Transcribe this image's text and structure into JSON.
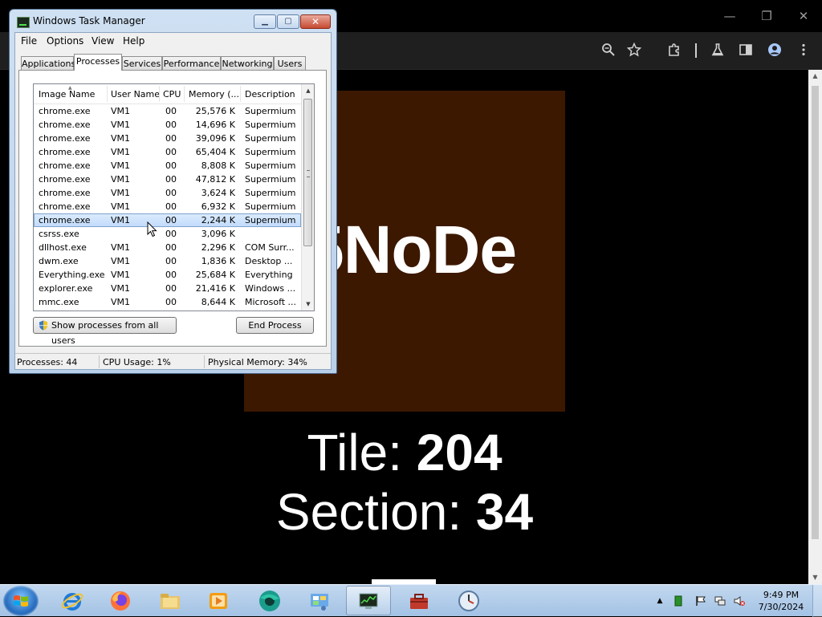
{
  "browser": {
    "window_controls": {
      "minimize": "—",
      "restore": "❐",
      "close": "✕"
    },
    "toolbar_icons": [
      "zoom-icon",
      "bookmark-star-icon",
      "extensions-icon",
      "labs-flask-icon",
      "side-panel-icon",
      "profile-icon",
      "menu-icon"
    ],
    "page": {
      "tile_text": "5NoDe",
      "tile_color": "#3c1800",
      "tile_label": "Tile:",
      "tile_number": "204",
      "section_label": "Section:",
      "section_number": "34"
    }
  },
  "task_manager": {
    "title": "Windows Task Manager",
    "title_buttons": {
      "minimize": "▁",
      "maximize": "▢",
      "close": "✕"
    },
    "menu": [
      "File",
      "Options",
      "View",
      "Help"
    ],
    "tabs": [
      "Applications",
      "Processes",
      "Services",
      "Performance",
      "Networking",
      "Users"
    ],
    "active_tab": "Processes",
    "columns": [
      "Image Name",
      "User Name",
      "CPU",
      "Memory (...",
      "Description"
    ],
    "rows": [
      {
        "name": "chrome.exe",
        "user": "VM1",
        "cpu": "00",
        "mem": "25,576 K",
        "desc": "Supermium"
      },
      {
        "name": "chrome.exe",
        "user": "VM1",
        "cpu": "00",
        "mem": "14,696 K",
        "desc": "Supermium"
      },
      {
        "name": "chrome.exe",
        "user": "VM1",
        "cpu": "00",
        "mem": "39,096 K",
        "desc": "Supermium"
      },
      {
        "name": "chrome.exe",
        "user": "VM1",
        "cpu": "00",
        "mem": "65,404 K",
        "desc": "Supermium"
      },
      {
        "name": "chrome.exe",
        "user": "VM1",
        "cpu": "00",
        "mem": "8,808 K",
        "desc": "Supermium"
      },
      {
        "name": "chrome.exe",
        "user": "VM1",
        "cpu": "00",
        "mem": "47,812 K",
        "desc": "Supermium"
      },
      {
        "name": "chrome.exe",
        "user": "VM1",
        "cpu": "00",
        "mem": "3,624 K",
        "desc": "Supermium"
      },
      {
        "name": "chrome.exe",
        "user": "VM1",
        "cpu": "00",
        "mem": "6,932 K",
        "desc": "Supermium"
      },
      {
        "name": "chrome.exe",
        "user": "VM1",
        "cpu": "00",
        "mem": "2,244 K",
        "desc": "Supermium",
        "selected": true
      },
      {
        "name": "csrss.exe",
        "user": "",
        "cpu": "00",
        "mem": "3,096 K",
        "desc": ""
      },
      {
        "name": "dllhost.exe",
        "user": "VM1",
        "cpu": "00",
        "mem": "2,296 K",
        "desc": "COM Surr..."
      },
      {
        "name": "dwm.exe",
        "user": "VM1",
        "cpu": "00",
        "mem": "1,836 K",
        "desc": "Desktop ..."
      },
      {
        "name": "Everything.exe",
        "user": "VM1",
        "cpu": "00",
        "mem": "25,684 K",
        "desc": "Everything"
      },
      {
        "name": "explorer.exe",
        "user": "VM1",
        "cpu": "00",
        "mem": "21,416 K",
        "desc": "Windows ..."
      },
      {
        "name": "mmc.exe",
        "user": "VM1",
        "cpu": "00",
        "mem": "8,644 K",
        "desc": "Microsoft ..."
      }
    ],
    "show_all_button": "Show processes from all users",
    "end_process_button": "End Process",
    "status": {
      "processes": "Processes: 44",
      "cpu": "CPU Usage: 1%",
      "memory": "Physical Memory: 34%"
    }
  },
  "taskbar": {
    "apps": [
      "internet-explorer-icon",
      "firefox-icon",
      "file-explorer-icon",
      "media-player-icon",
      "supermium-browser-icon",
      "control-panel-icon",
      "task-manager-icon",
      "toolbox-icon",
      "clock-app-icon"
    ],
    "active_app": "task-manager-icon",
    "tray": [
      "show-hidden-icons-arrow",
      "green-app-icon",
      "action-center-flag-icon",
      "network-icon",
      "volume-muted-icon"
    ],
    "clock_time": "9:49 PM",
    "clock_date": "7/30/2024"
  }
}
